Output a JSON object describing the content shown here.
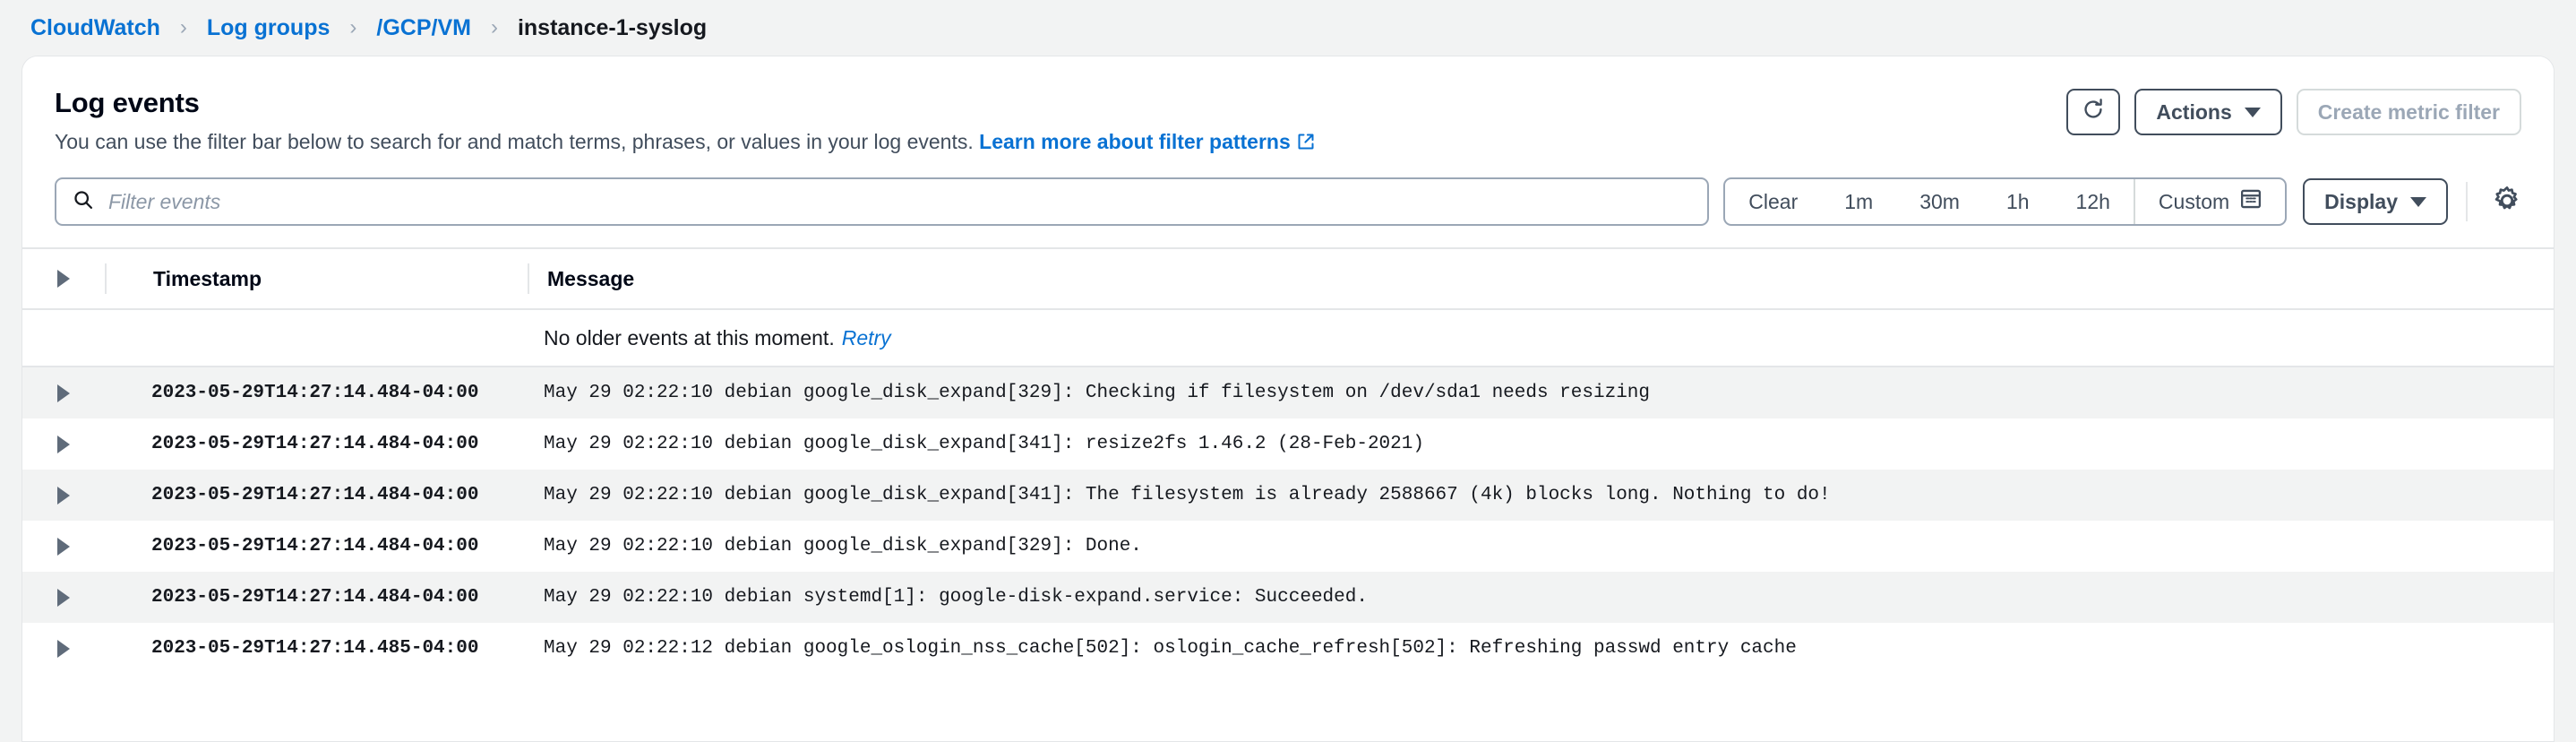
{
  "breadcrumb": {
    "items": [
      {
        "label": "CloudWatch",
        "current": false
      },
      {
        "label": "Log groups",
        "current": false
      },
      {
        "label": "/GCP/VM",
        "current": false
      },
      {
        "label": "instance-1-syslog",
        "current": true
      }
    ],
    "separator": "›"
  },
  "header": {
    "title": "Log events",
    "description_prefix": "You can use the filter bar below to search for and match terms, phrases, or values in your log events. ",
    "learn_more_label": "Learn more about filter patterns",
    "refresh_label": "refresh-icon",
    "actions_label": "Actions",
    "create_metric_filter_label": "Create metric filter",
    "create_metric_filter_disabled": true
  },
  "filter_bar": {
    "search_placeholder": "Filter events",
    "search_value": "",
    "ranges": [
      {
        "label": "Clear"
      },
      {
        "label": "1m"
      },
      {
        "label": "30m"
      },
      {
        "label": "1h"
      },
      {
        "label": "12h"
      },
      {
        "label": "Custom"
      }
    ],
    "display_label": "Display",
    "settings_icon": "gear-icon"
  },
  "table": {
    "columns": {
      "timestamp": "Timestamp",
      "message": "Message"
    },
    "notice": {
      "text": "No older events at this moment.",
      "retry_label": "Retry"
    },
    "rows": [
      {
        "timestamp": "2023-05-29T14:27:14.484-04:00",
        "message": "May 29 02:22:10 debian google_disk_expand[329]: Checking if filesystem on /dev/sda1 needs resizing"
      },
      {
        "timestamp": "2023-05-29T14:27:14.484-04:00",
        "message": "May 29 02:22:10 debian google_disk_expand[341]: resize2fs 1.46.2 (28-Feb-2021)"
      },
      {
        "timestamp": "2023-05-29T14:27:14.484-04:00",
        "message": "May 29 02:22:10 debian google_disk_expand[341]: The filesystem is already 2588667 (4k) blocks long. Nothing to do!"
      },
      {
        "timestamp": "2023-05-29T14:27:14.484-04:00",
        "message": "May 29 02:22:10 debian google_disk_expand[329]: Done."
      },
      {
        "timestamp": "2023-05-29T14:27:14.484-04:00",
        "message": "May 29 02:22:10 debian systemd[1]: google-disk-expand.service: Succeeded."
      },
      {
        "timestamp": "2023-05-29T14:27:14.485-04:00",
        "message": "May 29 02:22:12 debian google_oslogin_nss_cache[502]: oslogin_cache_refresh[502]: Refreshing passwd entry cache"
      }
    ]
  },
  "colors": {
    "link": "#0972d3",
    "text": "#16191f",
    "muted": "#414d5c",
    "row_alt": "#f2f3f3",
    "border": "#e4e6e8"
  }
}
